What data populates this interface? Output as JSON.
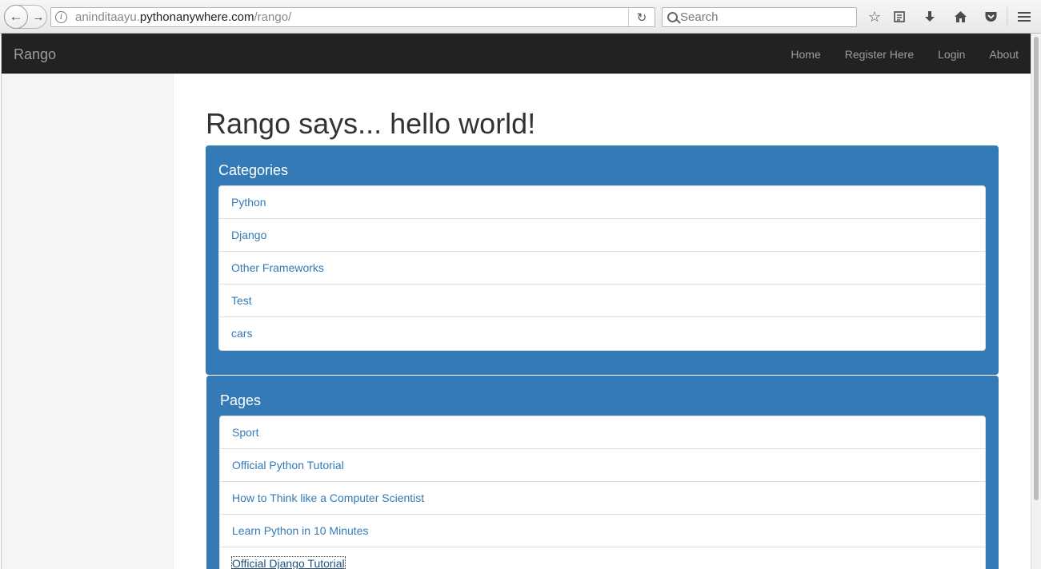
{
  "browser": {
    "url_prefix": "aninditaayu.",
    "url_domain": "pythonanywhere.com",
    "url_path": "/rango/",
    "search_placeholder": "Search",
    "icons": [
      "back-arrow-icon",
      "forward-arrow-icon",
      "info-icon",
      "reload-icon",
      "search-icon",
      "bookmark-star-icon",
      "reading-list-icon",
      "download-icon",
      "home-icon",
      "pocket-icon",
      "hamburger-menu-icon"
    ]
  },
  "navbar": {
    "brand": "Rango",
    "links": [
      "Home",
      "Register Here",
      "Login",
      "About"
    ]
  },
  "main": {
    "title": "Rango says... hello world!"
  },
  "categories": {
    "heading": "Categories",
    "items": [
      "Python",
      "Django",
      "Other Frameworks",
      "Test",
      "cars"
    ]
  },
  "pages": {
    "heading": "Pages",
    "items": [
      "Sport",
      "Official Python Tutorial",
      "How to Think like a Computer Scientist",
      "Learn Python in 10 Minutes",
      "Official Django Tutorial"
    ]
  },
  "colors": {
    "navbar_bg": "#222222",
    "panel_primary": "#337ab7",
    "link": "#337ab7"
  }
}
